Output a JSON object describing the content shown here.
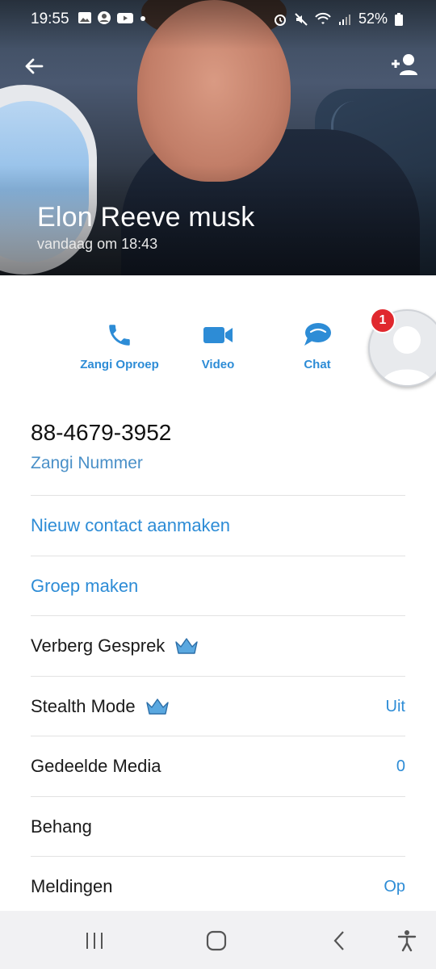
{
  "status_bar": {
    "time": "19:55",
    "battery": "52%"
  },
  "header": {
    "name": "Elon Reeve musk",
    "last_seen": "vandaag om 18:43"
  },
  "actions": [
    {
      "label": "Zangi Oproep",
      "icon": "phone-icon"
    },
    {
      "label": "Video",
      "icon": "video-icon"
    },
    {
      "label": "Chat",
      "icon": "chat-icon"
    }
  ],
  "avatar": {
    "badge_count": "1"
  },
  "contact": {
    "number": "88-4679-3952",
    "number_label": "Zangi Nummer"
  },
  "rows": [
    {
      "label": "Nieuw contact aanmaken",
      "value": ""
    },
    {
      "label": "Groep maken",
      "value": ""
    },
    {
      "label": "Verberg Gesprek",
      "value": "",
      "premium": true
    },
    {
      "label": "Stealth Mode",
      "value": "Uit",
      "premium": true
    },
    {
      "label": "Gedeelde Media",
      "value": "0"
    },
    {
      "label": "Behang",
      "value": ""
    },
    {
      "label": "Meldingen",
      "value": "Op"
    }
  ],
  "colors": {
    "accent": "#2d8cd6",
    "badge": "#e0282e"
  }
}
